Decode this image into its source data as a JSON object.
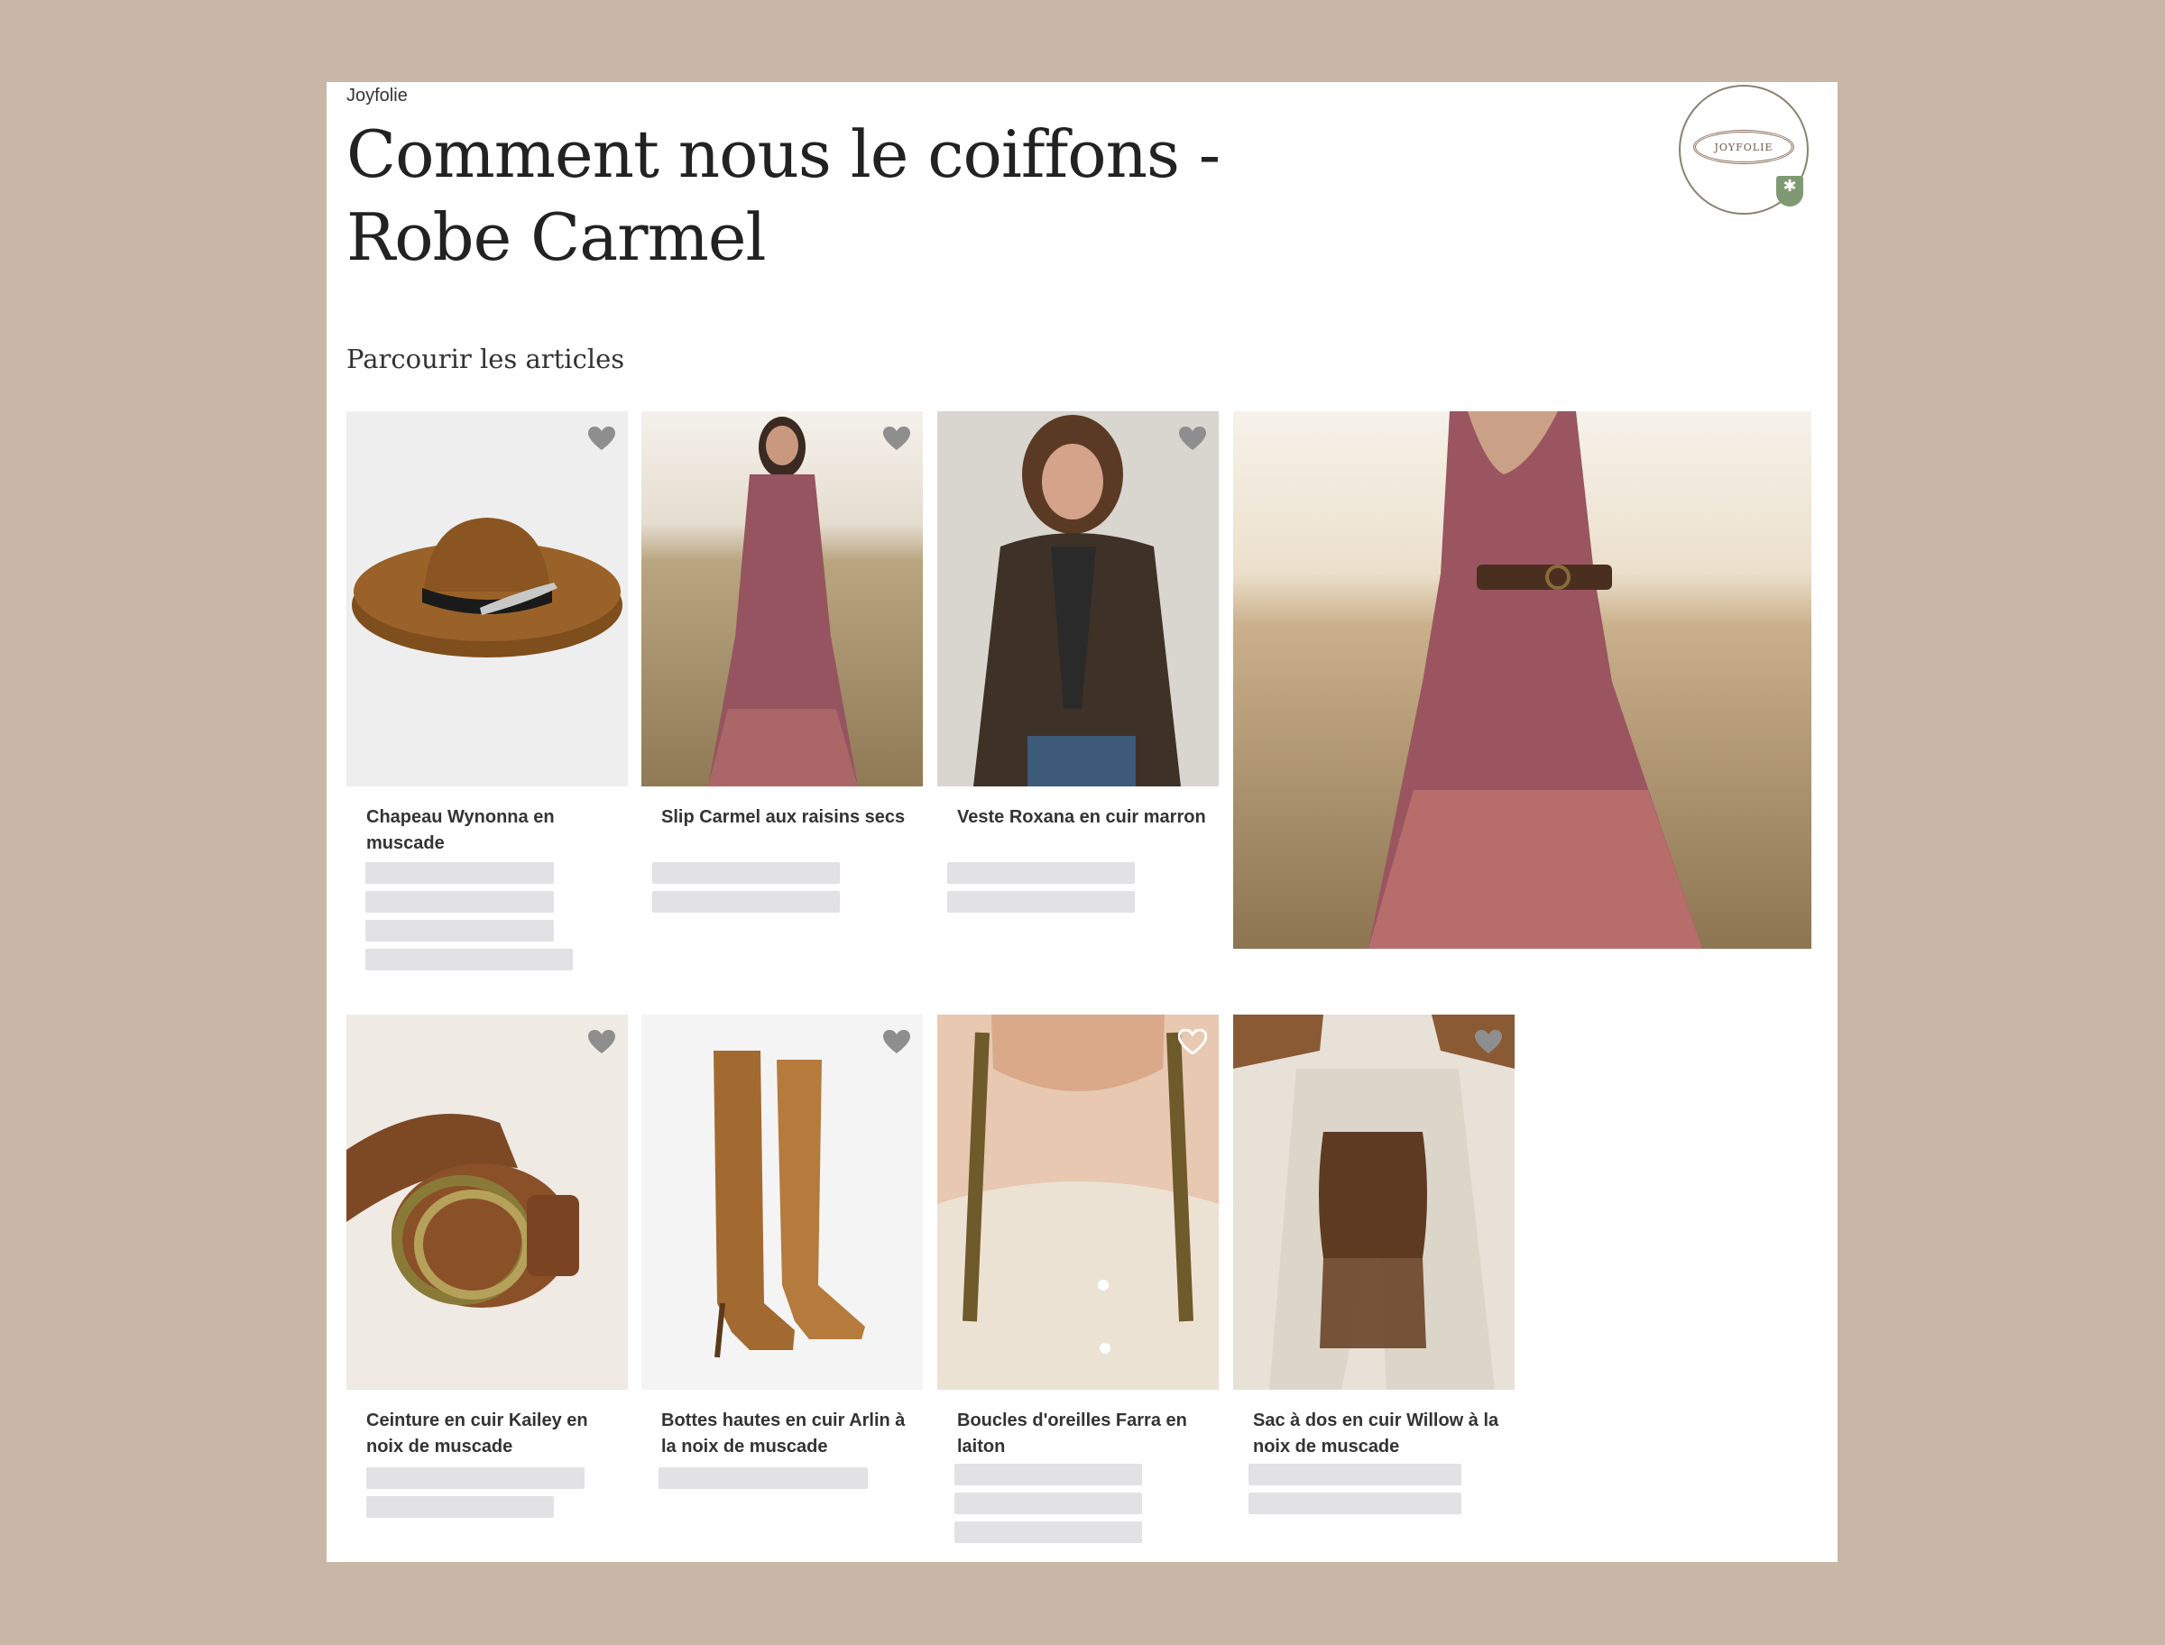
{
  "header": {
    "brand": "Joyfolie",
    "title": "Comment nous le coiffons - Robe Carmel",
    "logo_text": "JOYFOLIE"
  },
  "section_title": "Parcourir les articles",
  "products": [
    {
      "name": "Chapeau Wynonna en muscade",
      "image": "brown-hat-photo"
    },
    {
      "name": "Slip Carmel aux raisins secs",
      "image": "model-in-lace-dress-photo"
    },
    {
      "name": "Veste Roxana en cuir marron",
      "image": "leather-jacket-photo"
    },
    {
      "name": "Ceinture en cuir Kailey en noix de muscade",
      "image": "leather-belt-photo"
    },
    {
      "name": "Bottes hautes en cuir Arlin à la noix de muscade",
      "image": "suede-boots-photo"
    },
    {
      "name": "Boucles d'oreilles Farra en laiton",
      "image": "brass-earrings-photo"
    },
    {
      "name": "Sac à dos en cuir Willow à la noix de muscade",
      "image": "fringe-backpack-photo"
    }
  ],
  "feature_image": "model-in-field-photo",
  "colors": {
    "background": "#c8b6a6",
    "heart": "#8e8e8e",
    "skeleton": "#e2e2e4",
    "badge": "#7f9a73"
  },
  "icons": [
    "heart-icon",
    "logo-icon",
    "badge-icon"
  ]
}
